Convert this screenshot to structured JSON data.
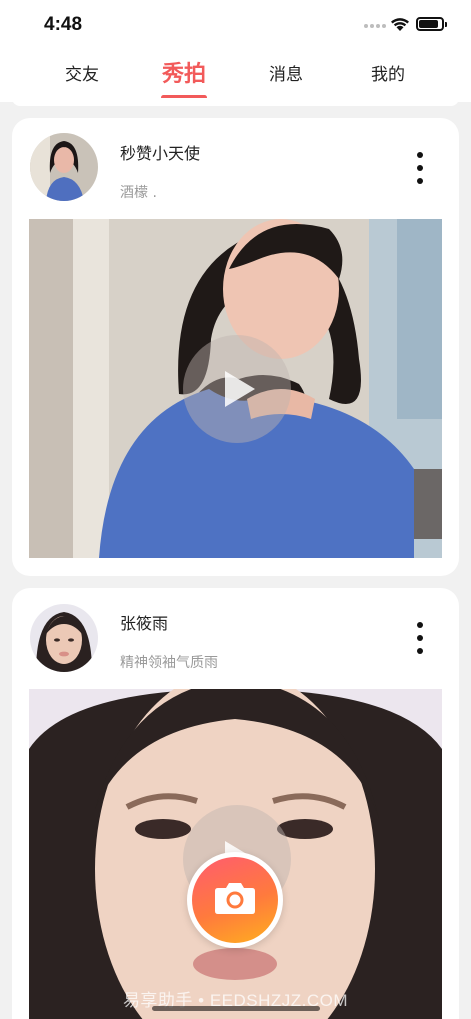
{
  "status_bar": {
    "time": "4:48"
  },
  "tabs": [
    {
      "label": "交友",
      "active": false
    },
    {
      "label": "秀拍",
      "active": true
    },
    {
      "label": "消息",
      "active": false
    },
    {
      "label": "我的",
      "active": false
    }
  ],
  "accent_color": "#f25a5a",
  "posts": [
    {
      "username": "秒赞小天使",
      "caption": "酒檬 ."
    },
    {
      "username": "张筱雨",
      "caption": "精神领袖气质雨"
    }
  ],
  "icons": {
    "more": "more-vertical-icon",
    "play": "play-icon",
    "camera": "camera-icon"
  },
  "watermark": "易享助手 • EEDSHZJZ.COM"
}
